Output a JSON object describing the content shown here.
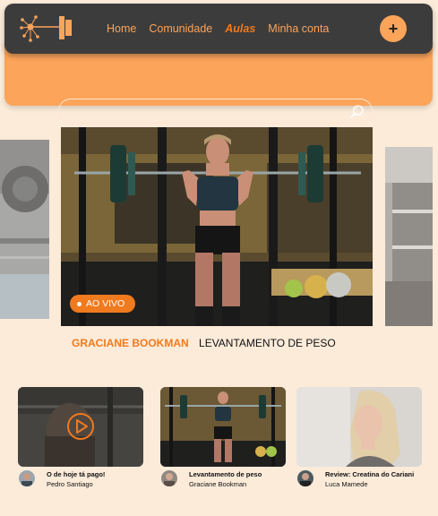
{
  "nav": {
    "items": [
      {
        "label": "Home"
      },
      {
        "label": "Comunidade"
      },
      {
        "label": "Aulas"
      },
      {
        "label": "Minha conta"
      }
    ],
    "add_label": "+"
  },
  "search": {
    "value": "",
    "placeholder": ""
  },
  "featured": {
    "live_label": "AO VIVO",
    "instructor": "GRACIANE BOOKMAN",
    "title": "LEVANTAMENTO DE PESO"
  },
  "videos": [
    {
      "title": "O de hoje tá pago!",
      "author": "Pedro Santiago"
    },
    {
      "title": "Levantamento de peso",
      "author": "Graciane Bookman"
    },
    {
      "title": "Review: Creatina do Cariani",
      "author": "Luca Mamede"
    }
  ],
  "colors": {
    "accent": "#f07a1e",
    "orange": "#fba45a",
    "dark": "#3c3c3c",
    "background": "#fcebd9"
  }
}
